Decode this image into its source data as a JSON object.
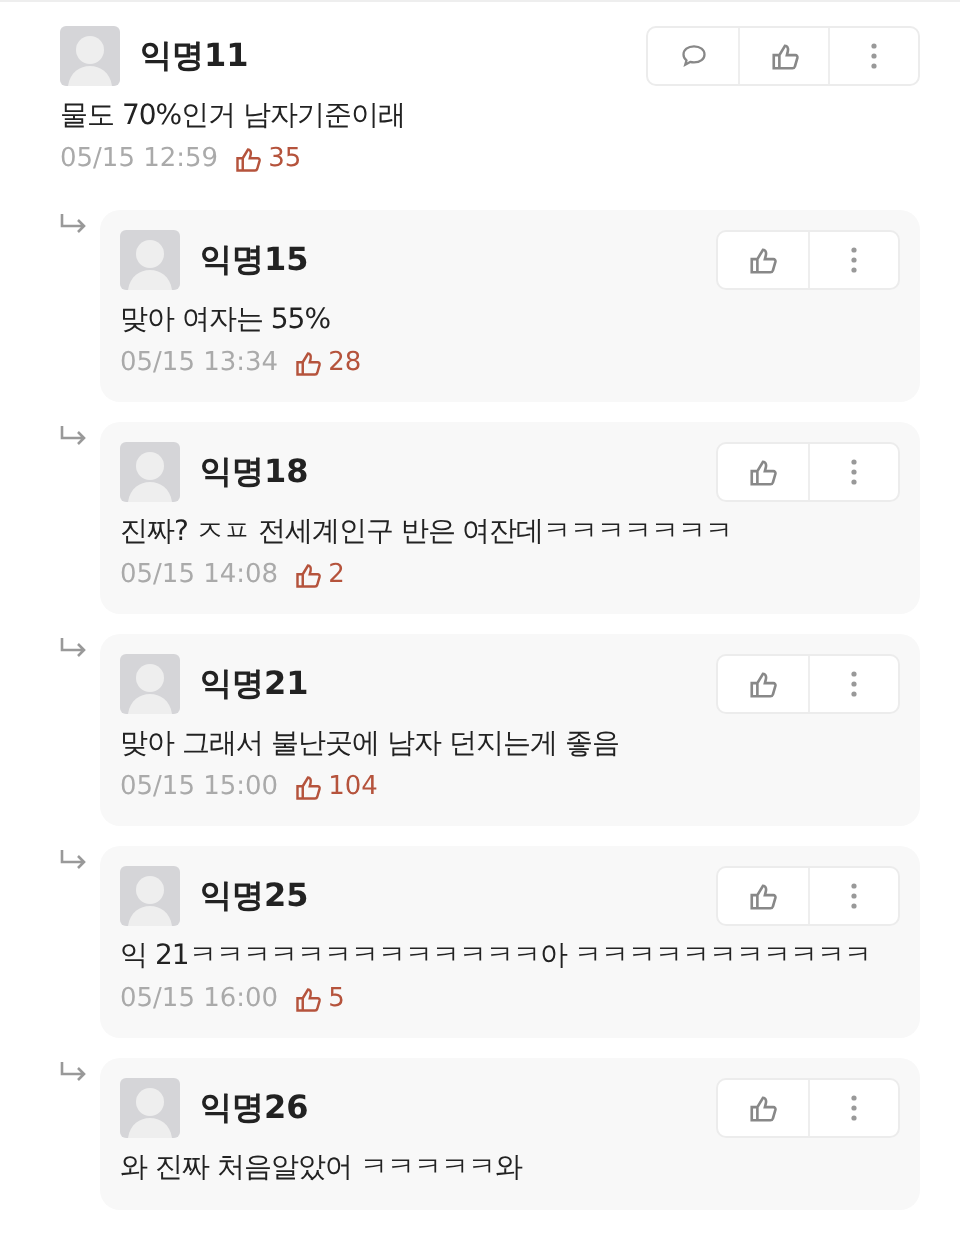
{
  "comments": [
    {
      "kind": "comment",
      "author": "익명11",
      "text": "물도 70%인거 남자기준이래",
      "time": "05/15 12:59",
      "likes": "35"
    },
    {
      "kind": "reply",
      "author": "익명15",
      "text": "맞아 여자는 55%",
      "time": "05/15 13:34",
      "likes": "28"
    },
    {
      "kind": "reply",
      "author": "익명18",
      "text": "진짜? ㅈㅍ 전세계인구 반은 여잔데ㅋㅋㅋㅋㅋㅋㅋ",
      "time": "05/15 14:08",
      "likes": "2"
    },
    {
      "kind": "reply",
      "author": "익명21",
      "text": "맞아 그래서 불난곳에 남자 던지는게 좋음",
      "time": "05/15 15:00",
      "likes": "104"
    },
    {
      "kind": "reply",
      "author": "익명25",
      "text": "익 21ㅋㅋㅋㅋㅋㅋㅋㅋㅋㅋㅋㅋㅋ아 ㅋㅋㅋㅋㅋㅋㅋㅋㅋㅋㅋ",
      "time": "05/15 16:00",
      "likes": "5"
    },
    {
      "kind": "reply",
      "author": "익명26",
      "text": "와 진짜 처음알았어 ㅋㅋㅋㅋㅋ와"
    }
  ]
}
